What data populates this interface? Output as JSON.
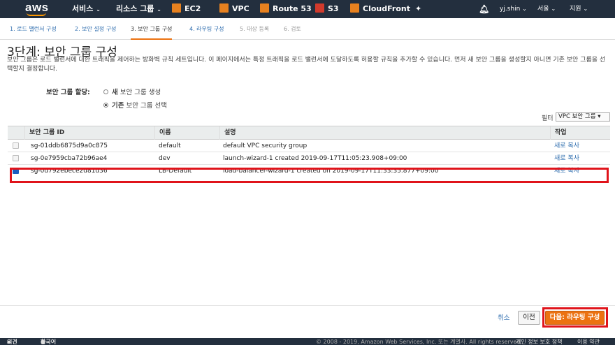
{
  "topnav": {
    "logo": "aws",
    "services": "서비스",
    "resource_groups": "리소스 그룹",
    "pin_icon": "pin-icon",
    "bell_icon": "bell-icon",
    "user": "yj.shin",
    "region": "서울",
    "support": "지원",
    "shortcuts": [
      {
        "label": "EC2",
        "color": "#e7811f"
      },
      {
        "label": "VPC",
        "color": "#e7811f"
      },
      {
        "label": "Route 53",
        "color": "#e7811f"
      },
      {
        "label": "S3",
        "color": "#d13a2c"
      },
      {
        "label": "CloudFront",
        "color": "#e7811f"
      }
    ]
  },
  "steps": [
    {
      "label": "1. 로드 밸런서 구성",
      "state": "link"
    },
    {
      "label": "2. 보안 설정 구성",
      "state": "link"
    },
    {
      "label": "3. 보안 그룹 구성",
      "state": "active"
    },
    {
      "label": "4. 라우팅 구성",
      "state": "link"
    },
    {
      "label": "5. 대상 등록",
      "state": "disabled"
    },
    {
      "label": "6. 검토",
      "state": "disabled"
    }
  ],
  "page": {
    "title": "3단계: 보안 그룹 구성",
    "description": "보안 그룹은 로드 밸런서에 대한 트래픽을 제어하는 방화벽 규칙 세트입니다. 이 페이지에서는 특정 트래픽을 로드 밸런서에 도달하도록 허용할 규칙을 추가할 수 있습니다. 먼저 새 보안 그룹을 생성할지 아니면 기존 보안 그룹을 선택할지 결정합니다.",
    "assign_label": "보안 그룹 할당:",
    "option_new_bold": "새",
    "option_new_rest": " 보안 그룹 생성",
    "option_existing_bold": "기존",
    "option_existing_rest": " 보안 그룹 선택",
    "filter_label": "필터",
    "filter_value": "VPC 보안 그룹 ▾"
  },
  "table": {
    "headers": [
      "보안 그룹 ID",
      "이름",
      "설명",
      "작업"
    ],
    "rows": [
      {
        "id": "sg-01ddb6875d9a0c875",
        "name": "default",
        "desc": "default VPC security group",
        "action": "새로 복사",
        "checked": false
      },
      {
        "id": "sg-0e7959cba72b96ae4",
        "name": "dev",
        "desc": "launch-wizard-1 created 2019-09-17T11:05:23.908+09:00",
        "action": "새로 복사",
        "checked": false
      },
      {
        "id": "sg-0d792ebece2d81d36",
        "name": "LB-Default",
        "desc": "load-balancer-wizard-1 created on 2019-09-17T11:33:35.877+09:00",
        "action": "새로 복사",
        "checked": true
      }
    ]
  },
  "actions": {
    "cancel": "취소",
    "previous": "이전",
    "next": "다음: 라우팅 구성"
  },
  "footer": {
    "feedback": "의견",
    "language": "한국어",
    "copyright": "© 2008 - 2019, Amazon Web Services, Inc. 또는 계열사. All rights reserved.",
    "privacy": "개인 정보 보호 정책",
    "terms": "이용 약관"
  }
}
